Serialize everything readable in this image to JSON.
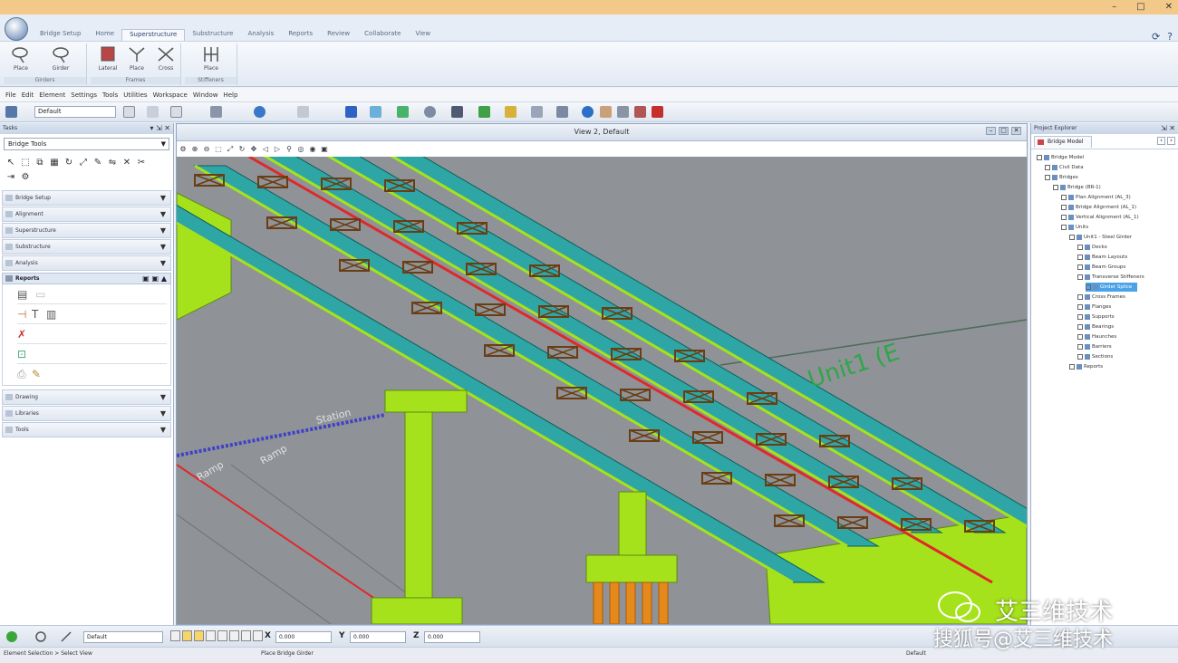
{
  "window": {
    "min_glyph": "–",
    "max_glyph": "□",
    "close_glyph": "✕"
  },
  "ribbon": {
    "tabs": [
      "Bridge Setup",
      "Home",
      "Superstructure",
      "Substructure",
      "Analysis",
      "Reports",
      "Review",
      "Collaborate",
      "View"
    ],
    "active_tab_index": 2,
    "help_glyph": "?",
    "groups": [
      {
        "label": "Girders",
        "buttons": [
          "Place",
          "Girder"
        ]
      },
      {
        "label": "Frames",
        "buttons": [
          "Lateral",
          "Place",
          "Cross"
        ]
      },
      {
        "label": "Stiffeners",
        "buttons": [
          "Place"
        ]
      }
    ]
  },
  "menubar": {
    "items": [
      "File",
      "Edit",
      "Element",
      "Settings",
      "Tools",
      "Utilities",
      "Workspace",
      "Window",
      "Help"
    ]
  },
  "toolbar": {
    "level_combo": "Default"
  },
  "left_panel": {
    "title": "Tasks",
    "tools_combo": "Bridge Tools",
    "sections": [
      "Bridge Setup",
      "Alignment",
      "Superstructure",
      "Substructure",
      "Analysis"
    ],
    "reports_title": "Reports",
    "lower_sections": [
      "Drawing",
      "Libraries",
      "Tools"
    ]
  },
  "viewport": {
    "title": "View 2, Default",
    "scene_labels": {
      "unit_label": "Unit1 (E",
      "station_label": "Station",
      "label_a": "Ramp",
      "label_b": "Ramp"
    },
    "colors": {
      "background": "#8f9397",
      "girder": "#2ea6a6",
      "deck_green": "#a6e21c",
      "frame": "#6b3d12",
      "centerline": "#e0282b",
      "pile": "#e6891b"
    }
  },
  "right_panel": {
    "title": "Project Explorer",
    "tab": "Bridge Model",
    "tree": [
      {
        "text": "Bridge Model",
        "indent": 0
      },
      {
        "text": "Civil Data",
        "indent": 1
      },
      {
        "text": "Bridges",
        "indent": 1
      },
      {
        "text": "Bridge (BR-1)",
        "indent": 2
      },
      {
        "text": "Plan Alignment (AL_3)",
        "indent": 3
      },
      {
        "text": "Bridge Alignment (AL_1)",
        "indent": 3
      },
      {
        "text": "Vertical Alignment (AL_1)",
        "indent": 3
      },
      {
        "text": "Units",
        "indent": 3
      },
      {
        "text": "Unit1 - Steel Girder",
        "indent": 4
      },
      {
        "text": "Decks",
        "indent": 5
      },
      {
        "text": "Beam Layouts",
        "indent": 5
      },
      {
        "text": "Beam Groups",
        "indent": 5
      },
      {
        "text": "Transverse Stiffeners",
        "indent": 5
      },
      {
        "text": "Girder Splice",
        "indent": 6,
        "selected": true
      },
      {
        "text": "Cross Frames",
        "indent": 5
      },
      {
        "text": "Flanges",
        "indent": 5
      },
      {
        "text": "Supports",
        "indent": 5
      },
      {
        "text": "Bearings",
        "indent": 5
      },
      {
        "text": "Haunches",
        "indent": 5
      },
      {
        "text": "Barriers",
        "indent": 5
      },
      {
        "text": "Sections",
        "indent": 5
      },
      {
        "text": "Reports",
        "indent": 4
      }
    ]
  },
  "bottom": {
    "level_combo": "Default",
    "x_label": "X",
    "x_value": "0.000",
    "y_label": "Y",
    "y_value": "0.000",
    "z_label": "Z",
    "z_value": "0.000",
    "status_left": "Element Selection > Select View",
    "status_mid": "Place Bridge Girder",
    "status_right": "Default"
  },
  "watermark": {
    "line1": "艾三维技术",
    "line2": "搜狐号@艾三维技术"
  }
}
